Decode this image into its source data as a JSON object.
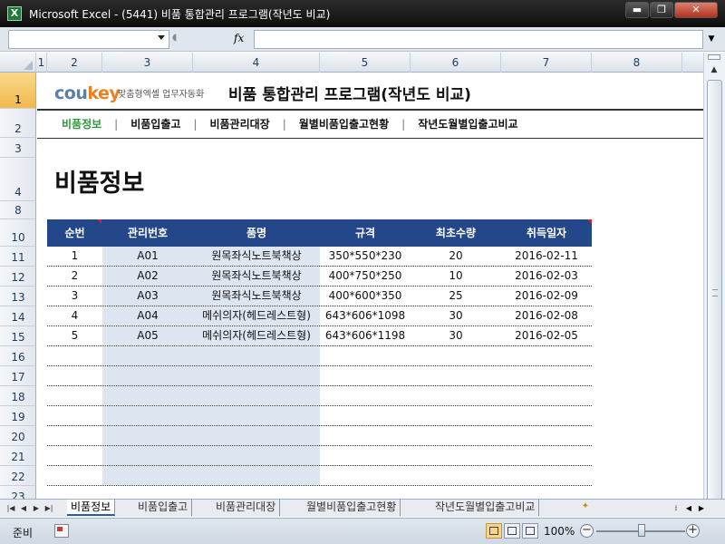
{
  "window": {
    "title": "Microsoft Excel - (5441) 비품 통합관리 프로그램(작년도 비교)",
    "app_icon": "X"
  },
  "window_controls": {
    "min": "▬",
    "max": "❐",
    "close": "✕"
  },
  "formula_bar": {
    "name_box": "",
    "fx": "fx",
    "formula": ""
  },
  "columns": [
    "1",
    "2",
    "3",
    "4",
    "5",
    "6",
    "7",
    "8"
  ],
  "rows": [
    "1",
    "2",
    "3",
    "4",
    "8",
    "10",
    "11",
    "12",
    "13",
    "14",
    "15",
    "16",
    "17",
    "18",
    "19",
    "20",
    "21",
    "22",
    "23"
  ],
  "header": {
    "brand_cou": "cou",
    "brand_key": "key",
    "brand_sub": "맞춤형엑셀 업무자동화",
    "title": "비품 통합관리 프로그램(작년도 비교)"
  },
  "nav": {
    "items": [
      "비품정보",
      "비품입출고",
      "비품관리대장",
      "월별비품입출고현황",
      "작년도월별입출고비교"
    ],
    "separator": "|"
  },
  "page_heading": "비품정보",
  "table": {
    "headers": [
      "순번",
      "관리번호",
      "품명",
      "규격",
      "최초수량",
      "취득일자"
    ],
    "rows": [
      [
        "1",
        "A01",
        "원목좌식노트북책상",
        "350*550*230",
        "20",
        "2016-02-11"
      ],
      [
        "2",
        "A02",
        "원목좌식노트북책상",
        "400*750*250",
        "10",
        "2016-02-03"
      ],
      [
        "3",
        "A03",
        "원목좌식노트북책상",
        "400*600*350",
        "25",
        "2016-02-09"
      ],
      [
        "4",
        "A04",
        "메쉬의자(헤드레스트형)",
        "643*606*1098",
        "30",
        "2016-02-08"
      ],
      [
        "5",
        "A05",
        "메쉬의자(헤드레스트형)",
        "643*606*1198",
        "30",
        "2016-02-05"
      ]
    ]
  },
  "sheet_tabs": {
    "items": [
      "비품정보",
      "비품입출고",
      "비품관리대장",
      "월별비품입출고현황",
      "작년도월별입출고비교"
    ],
    "active": 0
  },
  "status": {
    "text": "준비",
    "zoom": "100%",
    "zoom_minus": "−",
    "zoom_plus": "+"
  },
  "colors": {
    "table_header": "#24478a",
    "nav_active": "#2a9a3a",
    "brand": "#5b7fa6",
    "brand_accent": "#f07e1e"
  }
}
